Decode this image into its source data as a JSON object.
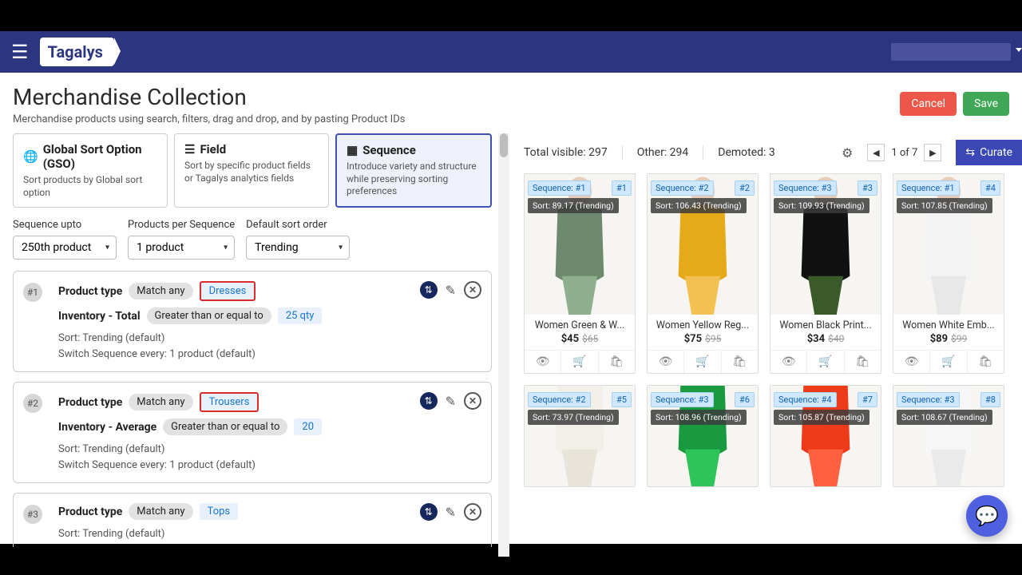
{
  "header": {
    "brand": "Tagalys"
  },
  "page": {
    "title": "Merchandise Collection",
    "subtitle": "Merchandise products using search, filters, drag and drop, and by pasting Product IDs",
    "cancel": "Cancel",
    "save": "Save"
  },
  "sort_tabs": [
    {
      "title": "Global Sort Option (GSO)",
      "desc": "Sort products by Global sort option",
      "icon": "globe"
    },
    {
      "title": "Field",
      "desc": "Sort by specific product fields or Tagalys analytics fields",
      "icon": "list"
    },
    {
      "title": "Sequence",
      "desc": "Introduce variety and structure while preserving sorting preferences",
      "icon": "grid",
      "active": true
    }
  ],
  "controls": {
    "seq_upto_label": "Sequence upto",
    "seq_upto_value": "250th product",
    "per_seq_label": "Products per Sequence",
    "per_seq_value": "1 product",
    "default_sort_label": "Default sort order",
    "default_sort_value": "Trending"
  },
  "rules": [
    {
      "num": "#1",
      "type_label": "Product type",
      "match": "Match any",
      "type_value": "Dresses",
      "boxed": true,
      "inv_label": "Inventory - Total",
      "inv_op": "Greater than or equal to",
      "inv_val": "25 qty",
      "sort_line": "Sort: Trending (default)",
      "switch_line": "Switch Sequence every: 1 product (default)"
    },
    {
      "num": "#2",
      "type_label": "Product type",
      "match": "Match any",
      "type_value": "Trousers",
      "boxed": true,
      "inv_label": "Inventory - Average",
      "inv_op": "Greater than or equal to",
      "inv_val": "20",
      "sort_line": "Sort: Trending (default)",
      "switch_line": "Switch Sequence every: 1 product (default)"
    },
    {
      "num": "#3",
      "type_label": "Product type",
      "match": "Match any",
      "type_value": "Tops",
      "boxed": false,
      "sort_line": "Sort: Trending (default)"
    }
  ],
  "grid_toolbar": {
    "visible": "Total visible: 297",
    "other": "Other: 294",
    "demoted": "Demoted: 3",
    "page": "1 of 7",
    "curate": "Curate"
  },
  "products_row1": [
    {
      "seq": "Sequence: #1",
      "rank": "#1",
      "sort": "Sort: 89.17 (Trending)",
      "title": "Women Green & W...",
      "price": "$45",
      "was": "$65",
      "c1": "#6e8a6e",
      "c2": "#8fb08f"
    },
    {
      "seq": "Sequence: #2",
      "rank": "#2",
      "sort": "Sort: 106.43 (Trending)",
      "title": "Women Yellow Reg...",
      "price": "$75",
      "was": "$95",
      "c1": "#e6a917",
      "c2": "#f3c152"
    },
    {
      "seq": "Sequence: #3",
      "rank": "#3",
      "sort": "Sort: 109.93 (Trending)",
      "title": "Women Black Print...",
      "price": "$34",
      "was": "$40",
      "c1": "#111",
      "c2": "#3a5a2a"
    },
    {
      "seq": "Sequence: #1",
      "rank": "#4",
      "sort": "Sort: 107.85 (Trending)",
      "title": "Women White Emb...",
      "price": "$89",
      "was": "$99",
      "c1": "#f4f4f4",
      "c2": "#e8e8e8"
    }
  ],
  "products_row2": [
    {
      "seq": "Sequence: #2",
      "rank": "#5",
      "sort": "Sort: 73.97 (Trending)",
      "c1": "#f2efe9",
      "c2": "#e8e4da"
    },
    {
      "seq": "Sequence: #3",
      "rank": "#6",
      "sort": "Sort: 108.96 (Trending)",
      "c1": "#1a9a3f",
      "c2": "#2fc45a"
    },
    {
      "seq": "Sequence: #4",
      "rank": "#7",
      "sort": "Sort: 105.87 (Trending)",
      "c1": "#ed3b1a",
      "c2": "#ff6140"
    },
    {
      "seq": "Sequence: #3",
      "rank": "#8",
      "sort": "Sort: 108.67 (Trending)",
      "c1": "#f6f6f6",
      "c2": "#eaeaea"
    }
  ]
}
